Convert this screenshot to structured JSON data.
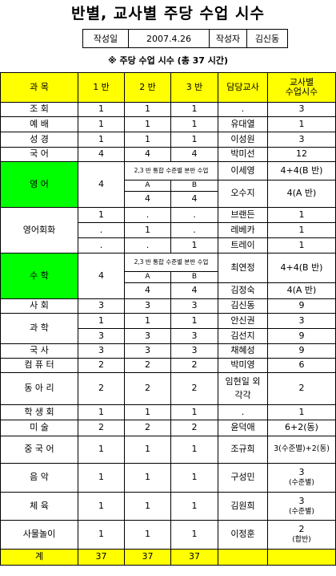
{
  "title": "반별, 교사별 주당 수업 시수",
  "meta": {
    "date_label": "작성일",
    "date": "2007.4.26",
    "author_label": "작성자",
    "author": "김신동"
  },
  "note": "※ 주당 수업 시수 (총 37 시간)",
  "header": {
    "subject": "과 목",
    "c1": "1 반",
    "c2": "2 반",
    "c3": "3 반",
    "teacher": "담당교사",
    "hours_l1": "교사별",
    "hours_l2": "수업시수"
  },
  "rows": {
    "r1": {
      "subject": "조 회",
      "c1": "1",
      "c2": "1",
      "c3": "1",
      "teacher": ".",
      "hours": "3"
    },
    "r2": {
      "subject": "예 배",
      "c1": "1",
      "c2": "1",
      "c3": "1",
      "teacher": "유대열",
      "hours": "1"
    },
    "r3": {
      "subject": "성 경",
      "c1": "1",
      "c2": "1",
      "c3": "1",
      "teacher": "이성원",
      "hours": "3"
    },
    "r4": {
      "subject": "국 어",
      "c1": "4",
      "c2": "4",
      "c3": "4",
      "teacher": "박미선",
      "hours": "12"
    },
    "eng": {
      "subject": "영 어",
      "c1": "4",
      "merged": "2,3 반 통합 수준별 분반 수업",
      "a": "A",
      "b": "B",
      "av": "4",
      "bv": "4",
      "t1": "이세영",
      "h1": "4+4(B 반)",
      "t2": "오수지",
      "h2": "4(A 반)"
    },
    "conv": {
      "subject": "영어회화",
      "a": {
        "c1": "1",
        "c2": ".",
        "c3": ".",
        "teacher": "브랜든",
        "hours": "1"
      },
      "b": {
        "c1": ".",
        "c2": "1",
        "c3": ".",
        "teacher": "레베카",
        "hours": "1"
      },
      "c": {
        "c1": ".",
        "c2": ".",
        "c3": "1",
        "teacher": "트레이",
        "hours": "1"
      }
    },
    "math": {
      "subject": "수 학",
      "c1": "4",
      "merged": "2,3 반 통합 수준별 분반 수업",
      "a": "A",
      "b": "B",
      "av": "4",
      "bv": "4",
      "t1": "최연정",
      "h1": "4+4(B 반)",
      "t2": "김정숙",
      "h2": "4(A 반)"
    },
    "soc": {
      "subject": "사 회",
      "c1": "3",
      "c2": "3",
      "c3": "3",
      "teacher": "김신동",
      "hours": "9"
    },
    "sci": {
      "subject": "과 학",
      "a": {
        "c1": "1",
        "c2": "1",
        "c3": "1",
        "teacher": "안신권",
        "hours": "3"
      },
      "b": {
        "c1": "3",
        "c2": "3",
        "c3": "3",
        "teacher": "김선지",
        "hours": "9"
      }
    },
    "hist": {
      "subject": "국 사",
      "c1": "3",
      "c2": "3",
      "c3": "3",
      "teacher": "채혜성",
      "hours": "9"
    },
    "comp": {
      "subject": "컴 퓨 터",
      "c1": "2",
      "c2": "2",
      "c3": "2",
      "teacher": "박미영",
      "hours": "6"
    },
    "club": {
      "subject": "동 아 리",
      "c1": "2",
      "c2": "2",
      "c3": "2",
      "teacher": "임현일 외 각각",
      "hours": "2"
    },
    "hr": {
      "subject": "학 생 회",
      "c1": "1",
      "c2": "1",
      "c3": "1",
      "teacher": ".",
      "hours": "1"
    },
    "art": {
      "subject": "미 술",
      "c1": "2",
      "c2": "2",
      "c3": "2",
      "teacher": "윤덕애",
      "hours": "6+2(동)"
    },
    "chn": {
      "subject": "중 국 어",
      "c1": "1",
      "c2": "1",
      "c3": "1",
      "teacher": "조규희",
      "hours": "3(수준별)+2(동)"
    },
    "mus": {
      "subject": "음 악",
      "c1": "1",
      "c2": "1",
      "c3": "1",
      "teacher": "구성민",
      "hours": "3",
      "hours_sub": "(수준별)"
    },
    "pe": {
      "subject": "체 육",
      "c1": "1",
      "c2": "1",
      "c3": "1",
      "teacher": "김원희",
      "hours": "3",
      "hours_sub": "(수준별)"
    },
    "trad": {
      "subject": "사물놀이",
      "c1": "1",
      "c2": "1",
      "c3": "1",
      "teacher": "이정훈",
      "hours": "2",
      "hours_sub": "(합반)"
    }
  },
  "footer": {
    "subject": "계",
    "c1": "37",
    "c2": "37",
    "c3": "37",
    "teacher": "",
    "hours": ""
  },
  "colors": {
    "header_bg": "#ffff00",
    "highlight": "#00ff00"
  }
}
